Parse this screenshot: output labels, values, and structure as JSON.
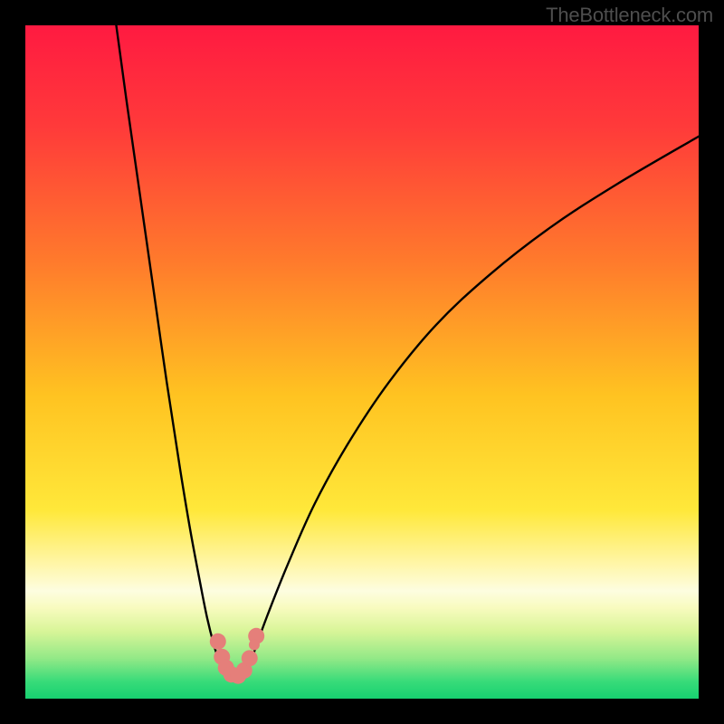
{
  "watermark": "TheBottleneck.com",
  "chart_data": {
    "type": "line",
    "title": "",
    "xlabel": "",
    "ylabel": "",
    "xlim": [
      0,
      100
    ],
    "ylim": [
      0,
      100
    ],
    "grid": false,
    "legend": false,
    "gradient_stops": [
      {
        "offset": 0.0,
        "color": "#ff1a41"
      },
      {
        "offset": 0.15,
        "color": "#ff3a3a"
      },
      {
        "offset": 0.35,
        "color": "#ff7a2c"
      },
      {
        "offset": 0.55,
        "color": "#ffc321"
      },
      {
        "offset": 0.72,
        "color": "#ffe83a"
      },
      {
        "offset": 0.8,
        "color": "#fff6a8"
      },
      {
        "offset": 0.84,
        "color": "#fdfde0"
      },
      {
        "offset": 0.865,
        "color": "#f8fbbf"
      },
      {
        "offset": 0.9,
        "color": "#d8f598"
      },
      {
        "offset": 0.94,
        "color": "#93e987"
      },
      {
        "offset": 0.975,
        "color": "#37db79"
      },
      {
        "offset": 1.0,
        "color": "#17d170"
      }
    ],
    "series": [
      {
        "name": "left-arm",
        "x": [
          13.5,
          15.0,
          17.0,
          19.0,
          21.0,
          23.0,
          24.5,
          26.0,
          27.0,
          28.0,
          28.8,
          29.3
        ],
        "y": [
          100.0,
          89.0,
          75.0,
          61.0,
          47.0,
          34.0,
          25.0,
          17.0,
          12.0,
          8.0,
          5.5,
          4.0
        ]
      },
      {
        "name": "right-arm",
        "x": [
          33.0,
          34.0,
          36.0,
          39.0,
          43.0,
          48.0,
          54.0,
          61.0,
          69.0,
          78.0,
          88.0,
          100.0
        ],
        "y": [
          4.0,
          7.0,
          12.5,
          20.0,
          29.0,
          38.0,
          47.0,
          55.5,
          63.0,
          70.0,
          76.5,
          83.5
        ]
      },
      {
        "name": "valley-floor",
        "x": [
          29.3,
          30.0,
          31.0,
          32.0,
          33.0
        ],
        "y": [
          4.0,
          3.3,
          3.0,
          3.3,
          4.0
        ]
      }
    ],
    "markers": {
      "name": "salmon-dots",
      "color": "#e57f7a",
      "radius_primary": 9,
      "radius_secondary": 6,
      "points": [
        {
          "x": 28.6,
          "y": 8.5,
          "r": 9
        },
        {
          "x": 29.2,
          "y": 6.2,
          "r": 9
        },
        {
          "x": 29.8,
          "y": 4.6,
          "r": 9
        },
        {
          "x": 30.6,
          "y": 3.6,
          "r": 9
        },
        {
          "x": 31.6,
          "y": 3.4,
          "r": 9
        },
        {
          "x": 32.5,
          "y": 4.2,
          "r": 9
        },
        {
          "x": 33.3,
          "y": 6.0,
          "r": 9
        },
        {
          "x": 34.3,
          "y": 9.3,
          "r": 9
        },
        {
          "x": 34.0,
          "y": 8.0,
          "r": 6
        }
      ]
    }
  }
}
